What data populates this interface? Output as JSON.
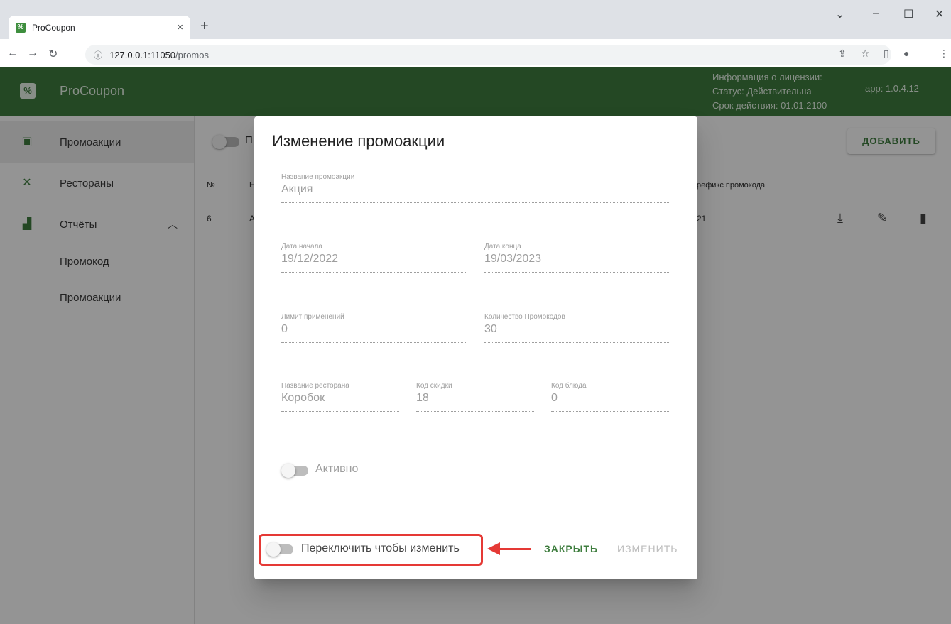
{
  "browser": {
    "tab_title": "ProCoupon",
    "tab_close": "×",
    "new_tab": "+",
    "url_host": "127.0.0.1:11050",
    "url_path": "/promos"
  },
  "app": {
    "name": "ProCoupon",
    "license_title": "Информация о лицензии:",
    "license_status": "Статус: Действительна",
    "license_expiry": "Срок действия: 01.01.2100",
    "version": "app: 1.0.4.12",
    "accent_color": "#3e7d3e"
  },
  "sidebar": {
    "items": [
      {
        "label": "Промоакции",
        "icon": "ticket-icon"
      },
      {
        "label": "Рестораны",
        "icon": "utensils-icon"
      },
      {
        "label": "Отчёты",
        "icon": "bar-chart-icon"
      }
    ],
    "sub_items": [
      "Промокод",
      "Промоакции"
    ]
  },
  "main": {
    "add_button": "ДОБАВИТЬ",
    "filter_toggle_label": "П",
    "columns": [
      "№",
      "Н",
      "рефикс промокода"
    ],
    "rows": [
      {
        "num": "6",
        "name": "А",
        "prefix": "21"
      }
    ]
  },
  "dialog": {
    "title": "Изменение промоакции",
    "name_label": "Название промоакции",
    "name_value": "Акция",
    "start_label": "Дата начала",
    "start_value": "19/12/2022",
    "end_label": "Дата конца",
    "end_value": "19/03/2023",
    "limit_label": "Лимит применений",
    "limit_value": "0",
    "count_label": "Количество Промокодов",
    "count_value": "30",
    "restaurant_label": "Название ресторана",
    "restaurant_value": "Коробок",
    "discount_label": "Код скидки",
    "discount_value": "18",
    "dish_label": "Код блюда",
    "dish_value": "0",
    "active_label": "Активно",
    "edit_toggle_label": "Переключить чтобы изменить",
    "close_button": "ЗАКРЫТЬ",
    "change_button": "ИЗМЕНИТЬ"
  }
}
